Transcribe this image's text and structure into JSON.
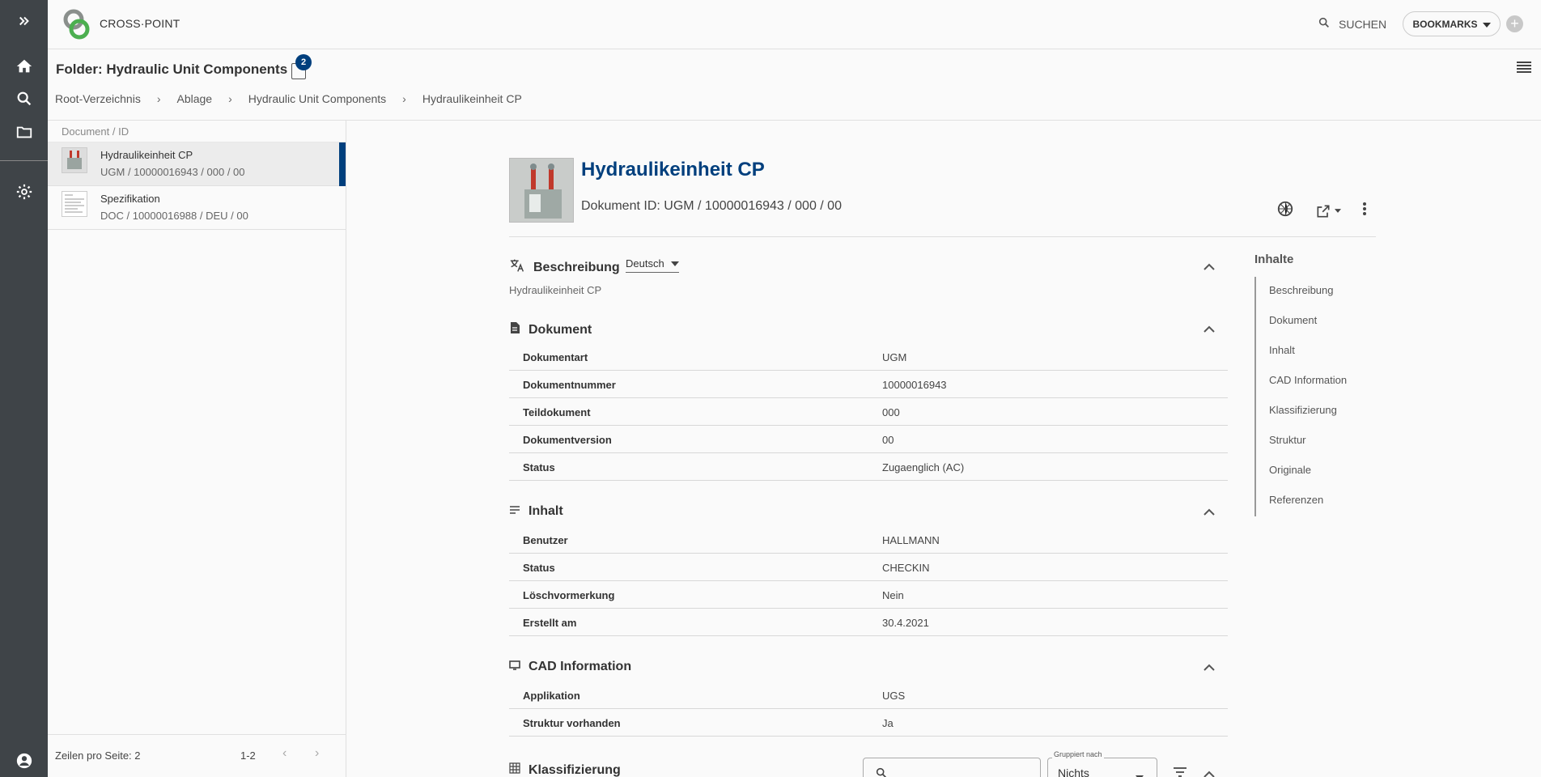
{
  "app": {
    "brand": "CROSS·POINT"
  },
  "header": {
    "search_label": "SUCHEN",
    "bookmarks_label": "BOOKMARKS"
  },
  "folder": {
    "title": "Folder: Hydraulic Unit Components",
    "badge_count": "2",
    "breadcrumb": [
      "Root-Verzeichnis",
      "Ablage",
      "Hydraulic Unit Components",
      "Hydraulikeinheit CP"
    ]
  },
  "list": {
    "header": "Document / ID",
    "items": [
      {
        "name": "Hydraulikeinheit CP",
        "sub": "UGM / 10000016943 / 000 / 00"
      },
      {
        "name": "Spezifikation",
        "sub": "DOC / 10000016988 / DEU / 00"
      }
    ],
    "rows_per_page": "Zeilen pro Seite: 2",
    "range": "1-2"
  },
  "detail": {
    "title": "Hydraulikeinheit CP",
    "doc_id": "Dokument ID: UGM / 10000016943 / 000 / 00",
    "beschreibung": {
      "title": "Beschreibung",
      "language": "Deutsch",
      "text": "Hydraulikeinheit CP"
    },
    "dokument": {
      "title": "Dokument",
      "rows": [
        {
          "k": "Dokumentart",
          "v": "UGM"
        },
        {
          "k": "Dokumentnummer",
          "v": "10000016943"
        },
        {
          "k": "Teildokument",
          "v": "000"
        },
        {
          "k": "Dokumentversion",
          "v": "00"
        },
        {
          "k": "Status",
          "v": "Zugaenglich (AC)"
        }
      ]
    },
    "inhalt": {
      "title": "Inhalt",
      "rows": [
        {
          "k": "Benutzer",
          "v": "HALLMANN"
        },
        {
          "k": "Status",
          "v": "CHECKIN"
        },
        {
          "k": "Löschvormerkung",
          "v": "Nein"
        },
        {
          "k": "Erstellt am",
          "v": "30.4.2021"
        }
      ]
    },
    "cad": {
      "title": "CAD Information",
      "rows": [
        {
          "k": "Applikation",
          "v": "UGS"
        },
        {
          "k": "Struktur vorhanden",
          "v": "Ja"
        }
      ]
    },
    "klassifizierung": {
      "title": "Klassifizierung",
      "group_label": "Gruppiert nach",
      "group_value": "Nichts"
    }
  },
  "toc": {
    "title": "Inhalte",
    "items": [
      "Beschreibung",
      "Dokument",
      "Inhalt",
      "CAD Information",
      "Klassifizierung",
      "Struktur",
      "Originale",
      "Referenzen"
    ]
  },
  "colors": {
    "accent": "#003f7d",
    "rail": "#3f4448"
  }
}
